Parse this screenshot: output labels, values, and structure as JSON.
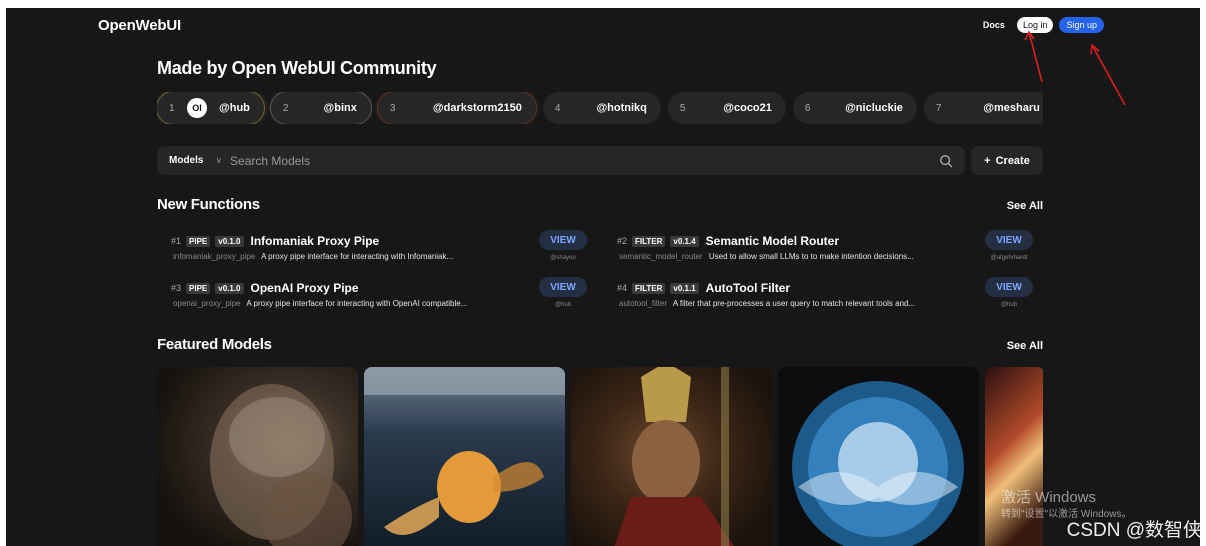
{
  "header": {
    "brand": "OpenWebUI",
    "docs": "Docs",
    "login": "Log in",
    "signup": "Sign up"
  },
  "community": {
    "title": "Made by Open WebUI Community",
    "authors": [
      {
        "rank": "1",
        "handle": "@hub",
        "logo": "OI"
      },
      {
        "rank": "2",
        "handle": "@binx"
      },
      {
        "rank": "3",
        "handle": "@darkstorm2150"
      },
      {
        "rank": "4",
        "handle": "@hotnikq"
      },
      {
        "rank": "5",
        "handle": "@coco21"
      },
      {
        "rank": "6",
        "handle": "@nicluckie"
      },
      {
        "rank": "7",
        "handle": "@mesharu"
      }
    ]
  },
  "search": {
    "filter": "Models",
    "placeholder": "Search Models",
    "create": "Create"
  },
  "functions": {
    "title": "New Functions",
    "see_all": "See All",
    "items": [
      {
        "num": "#1",
        "type": "PIPE",
        "version": "v0.1.0",
        "name": "Infomaniak Proxy Pipe",
        "id": "infomaniak_proxy_pipe",
        "desc": "A proxy pipe interface for interacting with Infomaniak...",
        "view": "VIEW",
        "author": "@shayoo"
      },
      {
        "num": "#2",
        "type": "FILTER",
        "version": "v0.1.4",
        "name": "Semantic Model Router",
        "id": "semantic_model_router",
        "desc": "Used to allow small LLMs to to make intention decisions...",
        "view": "VIEW",
        "author": "@atgehrhardt"
      },
      {
        "num": "#3",
        "type": "PIPE",
        "version": "v0.1.0",
        "name": "OpenAI Proxy Pipe",
        "id": "openai_proxy_pipe",
        "desc": "A proxy pipe interface for interacting with OpenAI compatible...",
        "view": "VIEW",
        "author": "@hub"
      },
      {
        "num": "#4",
        "type": "FILTER",
        "version": "v0.1.1",
        "name": "AutoTool Filter",
        "id": "autotool_filter",
        "desc": "A filter that pre-processes a user query to match relevant tools and...",
        "view": "VIEW",
        "author": "@hub"
      }
    ]
  },
  "featured": {
    "title": "Featured Models",
    "see_all": "See All"
  },
  "watermark": {
    "activate_title": "激活 Windows",
    "activate_sub": "转到\"设置\"以激活 Windows。",
    "csdn": "CSDN @数智侠"
  },
  "colors": {
    "background": "#171717",
    "surface": "#262626",
    "accent_blue": "#2563eb",
    "view_text": "#7ea6ff"
  }
}
